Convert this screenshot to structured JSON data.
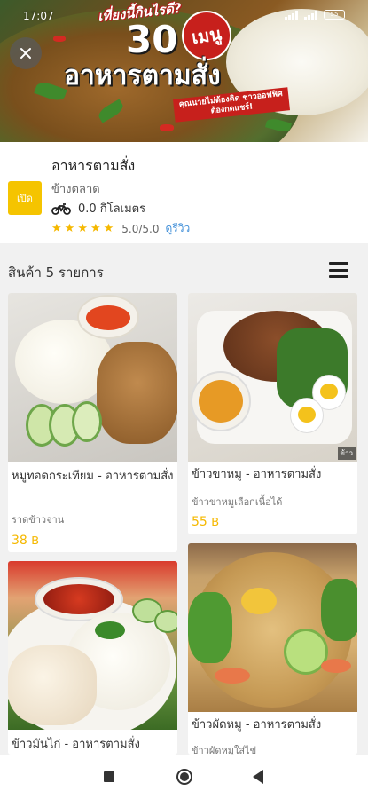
{
  "status_bar": {
    "time": "17:07",
    "battery": "55"
  },
  "banner": {
    "top_text": "เที่ยงนี้กินไรดี?",
    "number": "30",
    "badge": "เมนู",
    "title": "อาหารตามสั่ง",
    "subtitle": "คุณนายไม่ต้องคิด ชาวออฟฟิศต้องกดแชร์!"
  },
  "store": {
    "open_label": "เปิด",
    "name": "อาหารตามสั่ง",
    "area": "ข้างตลาด",
    "distance": "0.0 กิโลเมตร",
    "rating_text": "5.0/5.0",
    "review_link": "ดูรีวิว",
    "stars": 5
  },
  "products": {
    "count_label": "สินค้า 5 รายการ",
    "items": [
      {
        "name": "หมูทอดกระเทียม - อาหารตามสั่ง",
        "desc": "ราดข้าวจาน",
        "price": "38 ฿"
      },
      {
        "name": "ข้าวขาหมู - อาหารตามสั่ง",
        "desc": "ข้าวขาหมูเลือกเนื้อได้",
        "price": "55 ฿",
        "watermark": "ข้าว"
      },
      {
        "name": "ข้าวมันไก่ - อาหารตามสั่ง",
        "desc": "",
        "price": ""
      },
      {
        "name": "ข้าวผัดหมู - อาหารตามสั่ง",
        "desc": "ข้าวผัดหมูใส่ไข่",
        "price": ""
      }
    ]
  },
  "colors": {
    "accent": "#f5c400",
    "price": "#f5b800",
    "link": "#3f8ed8"
  },
  "icons": {
    "close": "close-icon",
    "motorbike": "motorbike-icon",
    "menu": "hamburger-menu-icon"
  }
}
